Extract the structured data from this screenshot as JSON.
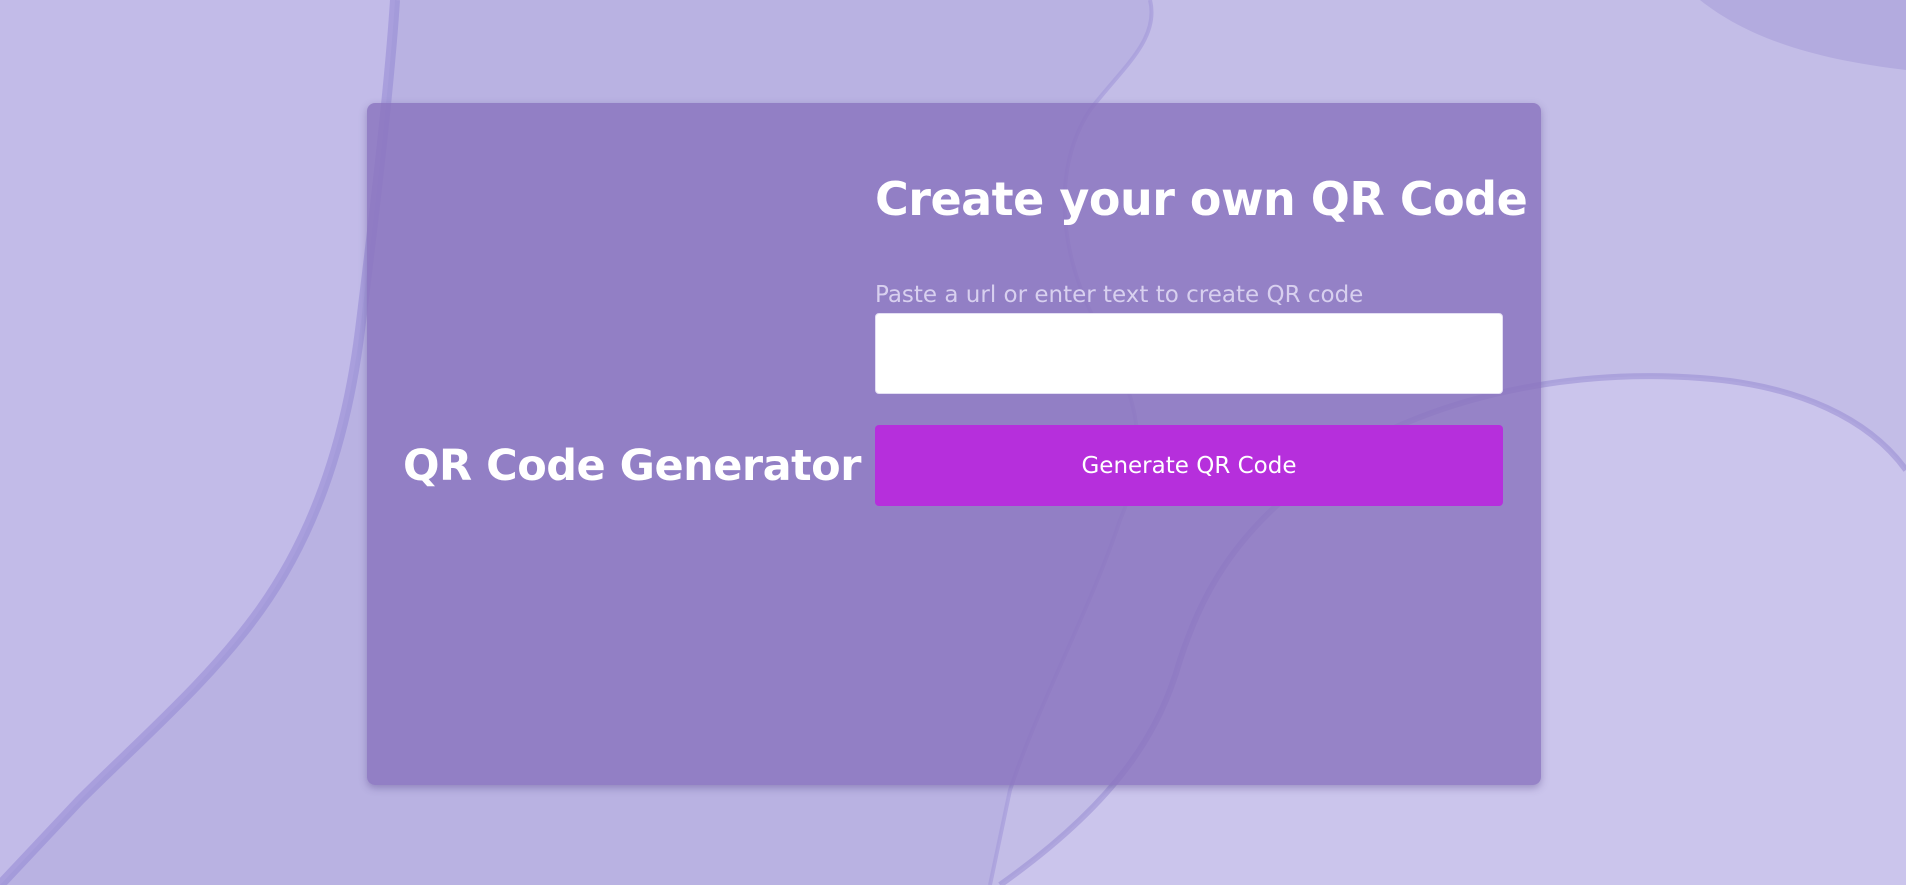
{
  "app": {
    "brand_title": "QR Code Generator"
  },
  "form": {
    "title": "Create your own QR Code",
    "input_label": "Paste a url or enter text to create QR code",
    "input_value": "",
    "generate_label": "Generate QR Code"
  },
  "colors": {
    "background": "#b9b2e2",
    "card": "#8a74be",
    "button": "#b62fdc",
    "text": "#ffffff"
  }
}
